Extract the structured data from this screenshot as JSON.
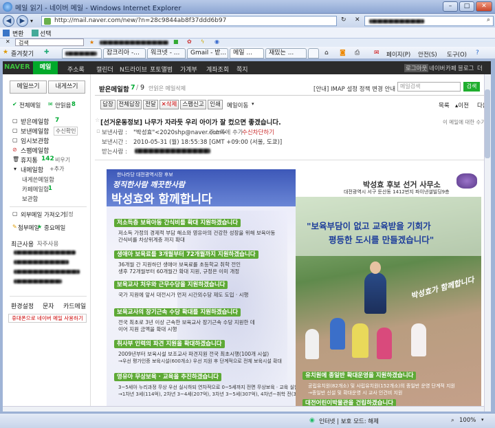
{
  "window": {
    "title": "메일 읽기 - 네이버 메일 - Windows Internet Explorer"
  },
  "browser": {
    "url": "http://mail.naver.com/new/?n=28c9844ab8f37ddd6b97",
    "menu": [
      "변환",
      "선택"
    ],
    "search_label": "검색",
    "favorites_label": "즐겨찾기",
    "tabs": [
      "잡크리아 -...",
      "워크넷 - ...",
      "Gmail - 받...",
      "메일 ...",
      "재밌는 ..."
    ],
    "tools": [
      "페이지(P)",
      "안전(S)",
      "도구(O)"
    ]
  },
  "naver": {
    "logo": "NAVER",
    "nav": [
      "메일",
      "주소록",
      "캘린더",
      "N드라이브",
      "포토앨범",
      "가계부",
      "계좌조회",
      "쪽지"
    ],
    "right_links": [
      "로그아웃",
      "네이버",
      "카페",
      "블로그",
      "더"
    ]
  },
  "sidebar": {
    "compose": "메일쓰기",
    "to_me": "내게쓰기",
    "all_mail": "전체메일",
    "unread": "안읽음",
    "unread_count": "8",
    "folders": [
      {
        "label": "받은메일함",
        "count": "7"
      },
      {
        "label": "보낸메일함",
        "extra": "수신확인"
      },
      {
        "label": "임시보관함"
      },
      {
        "label": "스팸메일함"
      },
      {
        "label": "휴지통",
        "count": "142",
        "extra": "비우기"
      },
      {
        "label": "내메일함",
        "extra": "+추가"
      }
    ],
    "subfolders": [
      {
        "label": "내게쓴메일함"
      },
      {
        "label": "카페메일함",
        "count": "1"
      },
      {
        "label": "보관함"
      }
    ],
    "external": "외부메일 가져오기",
    "external_link": "설정",
    "important": "중요메일",
    "attachments": "첨부메일",
    "recent_header": "최근사용",
    "recent_frequent": "자주사용",
    "settings": [
      "환경설정",
      "문자",
      "카드메일"
    ],
    "mobile": "휴대폰으로 네이버 메일 사용하기"
  },
  "main": {
    "inbox_label": "받은메일함",
    "inbox_unread": "7",
    "inbox_total": "9",
    "unread_link": "안읽은 메일삭제",
    "imap_notice": "[안내] IMAP 설정 정책 변경 안내",
    "search_placeholder": "메일검색",
    "search_button": "검색",
    "toolbar": [
      "답장",
      "전체답장",
      "전달",
      "✕삭제",
      "스팸신고",
      "인쇄",
      "메일이동"
    ],
    "list_link": "목록",
    "prev_link": "▴이전",
    "next_link": "다음▾",
    "subject": "[선거운동정보] 나무가 자라듯 우리 아이가 잘 컸으면 좋겠습니다.",
    "side_note": "이 메일에 대한 수기착",
    "sender_label": "보낸사람 :",
    "sender": "\"박성효\"<2020shp@naver.com>",
    "address_add": "주소록에 추가",
    "block": "수신차단하기",
    "date_label": "보낸시간 :",
    "date": "2010-05-31 (월) 18:55:38 [GMT +09:00 (서울, 도쿄)]",
    "to_label": "받는사람 :"
  },
  "poster": {
    "party": "한나라당 대전광역시장 후보",
    "slogan_top": "정직한사람 깨끗한사람",
    "slogan_main": "박성효와 함께합니다",
    "office": "박성효 후보 선거 사무소",
    "office_addr": "대전광역시 서구 둔산동 1412번지 파이낸셜빌딩9층",
    "headline_1": "\"보육부담이 없고 교육받을 기회가",
    "headline_2": "평등한 도시를 만들겠습니다\"",
    "signature": "박성효가 함께합니다",
    "bullets": [
      {
        "title": "저소득층 보육아동 간식비를 확대 지원하겠습니다",
        "text": [
          "저소득 가정의 경제적 부담 해소와 영유아의 건강한 성장을 위해 보육아동",
          "간식비를 차상위계층 까지 확대"
        ]
      },
      {
        "title": "생애아 보육료를 3개월부터 72개월까지 지원하겠습니다",
        "text": [
          "36개월 간 지원하던 생애아 보육료를 초등학교 취학 전인",
          "생후 72개월부터 60개월간 확대 지원, 규정은 이미 개정"
        ]
      },
      {
        "title": "보육교사 처우와 근무수당을 지원하겠습니다",
        "text": [
          "국가 지원에 앞서 대전시가 먼저 시간외수당 제도 도입 · 시행"
        ]
      },
      {
        "title": "보육교사의 장기근속 수당 확대를 지원하겠습니다",
        "text": [
          "전국 최초로 3년 이상 근속한 보육교사 장기근속 수당 지원한 데",
          "이어 지원 금액을 확대 시행"
        ]
      },
      {
        "title": "취사부 인력의 파견 지원을 확대하겠습니다",
        "text": [
          "2009년부터 보육시설 보조교사 파견지원 전국 최초시행(100개 시설)",
          "→우선 평가인증 보육시설(600개소) 우선 지원 후 단계적으로 전체 보육시설 확대"
        ]
      },
      {
        "title": "영유아 무상보육 · 교육을 추진하겠습니다",
        "text": [
          "3~5세아 누리과정 무상 우선 실시하되 연차적으로 0~5세까지 전면 무상보육 · 교육 실현",
          "→1차년 3세(114억), 2차년 3~4세(207억), 3차년 3~5세(307억), 4차년~취학 전(313억)"
        ]
      }
    ],
    "right_bullets": [
      {
        "title": "유치원에 종일반 확대운영을 지원하겠습니다",
        "text": [
          "공립유치원(82개소) 및 사립유치원(152개소)의 종일반 운영 단계적 지원",
          "→종일반 신설 및 확대운영 시 교사 인건비 지원"
        ]
      },
      {
        "title": "대전어린이박물관을 건립하겠습니다",
        "text": []
      }
    ]
  },
  "status": {
    "zone": "인터넷 | 보호 모드: 해제",
    "zoom": "100%"
  }
}
